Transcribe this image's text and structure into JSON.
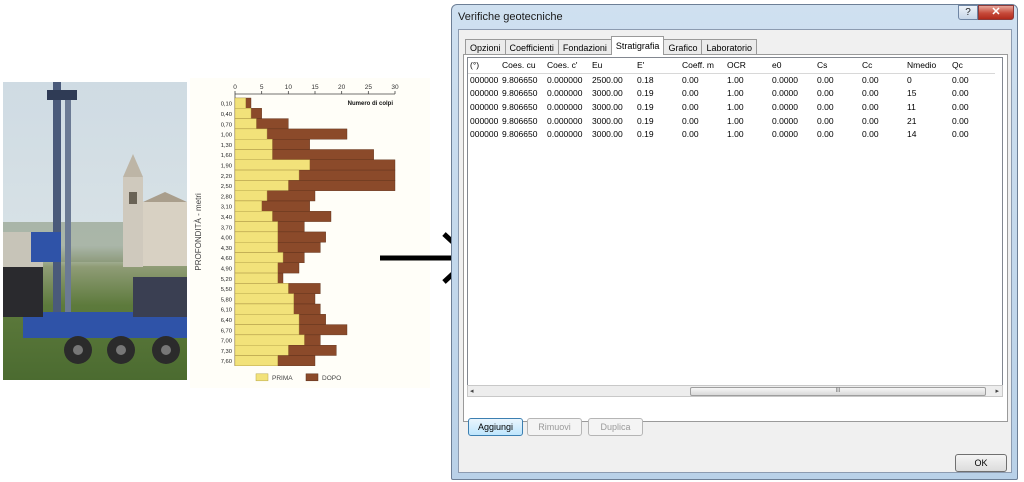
{
  "window": {
    "title": "Verifiche geotecniche",
    "help_label": "?",
    "close_label": "✕"
  },
  "tabs": [
    {
      "label": "Opzioni"
    },
    {
      "label": "Coefficienti"
    },
    {
      "label": "Fondazioni"
    },
    {
      "label": "Stratigrafia"
    },
    {
      "label": "Grafico"
    },
    {
      "label": "Laboratorio"
    }
  ],
  "active_tab": "Stratigrafia",
  "table": {
    "headers": [
      "(°)",
      "Coes. cu",
      "Coes. c'",
      "Eu",
      "E'",
      "Coeff. m",
      "OCR",
      "e0",
      "Cs",
      "Cc",
      "Nmedio",
      "Qc"
    ],
    "rows": [
      [
        "000000",
        "9.806650",
        "0.000000",
        "2500.00",
        "0.18",
        "0.00",
        "1.00",
        "0.0000",
        "0.00",
        "0.00",
        "0",
        "0.00"
      ],
      [
        "000000",
        "9.806650",
        "0.000000",
        "3000.00",
        "0.19",
        "0.00",
        "1.00",
        "0.0000",
        "0.00",
        "0.00",
        "15",
        "0.00"
      ],
      [
        "000000",
        "9.806650",
        "0.000000",
        "3000.00",
        "0.19",
        "0.00",
        "1.00",
        "0.0000",
        "0.00",
        "0.00",
        "11",
        "0.00"
      ],
      [
        "000000",
        "9.806650",
        "0.000000",
        "3000.00",
        "0.19",
        "0.00",
        "1.00",
        "0.0000",
        "0.00",
        "0.00",
        "21",
        "0.00"
      ],
      [
        "000000",
        "9.806650",
        "0.000000",
        "3000.00",
        "0.19",
        "0.00",
        "1.00",
        "0.0000",
        "0.00",
        "0.00",
        "14",
        "0.00"
      ]
    ]
  },
  "scrollbar": {
    "left": "◂",
    "right": "▸",
    "grip": "III"
  },
  "buttons": {
    "add": "Aggiungi",
    "remove": "Rimuovi",
    "duplicate": "Duplica",
    "ok": "OK"
  },
  "chart_data": {
    "type": "bar",
    "orientation": "horizontal",
    "title": "Numero di colpi",
    "ylabel": "PROFONDITÀ - metri",
    "xlim": [
      0,
      30
    ],
    "xticks": [
      "0",
      "5",
      "10",
      "15",
      "20",
      "25",
      "30"
    ],
    "categories": [
      "0,10",
      "0,40",
      "0,70",
      "1,00",
      "1,30",
      "1,60",
      "1,90",
      "2,20",
      "2,50",
      "2,80",
      "3,10",
      "3,40",
      "3,70",
      "4,00",
      "4,30",
      "4,60",
      "4,90",
      "5,20",
      "5,50",
      "5,80",
      "6,10",
      "6,40",
      "6,70",
      "7,00",
      "7,30",
      "7,60"
    ],
    "series": [
      {
        "name": "PRIMA",
        "color": "#f2e27a",
        "values": [
          2,
          3,
          4,
          6,
          7,
          7,
          14,
          12,
          10,
          6,
          5,
          7,
          8,
          8,
          8,
          9,
          8,
          8,
          10,
          11,
          11,
          12,
          12,
          13,
          10,
          8
        ]
      },
      {
        "name": "DOPO",
        "color": "#8b4a2a",
        "values": [
          3,
          5,
          10,
          21,
          14,
          26,
          30,
          30,
          30,
          15,
          14,
          18,
          13,
          17,
          16,
          13,
          12,
          9,
          16,
          15,
          16,
          17,
          21,
          16,
          19,
          15
        ]
      }
    ],
    "legend_position": "bottom"
  }
}
